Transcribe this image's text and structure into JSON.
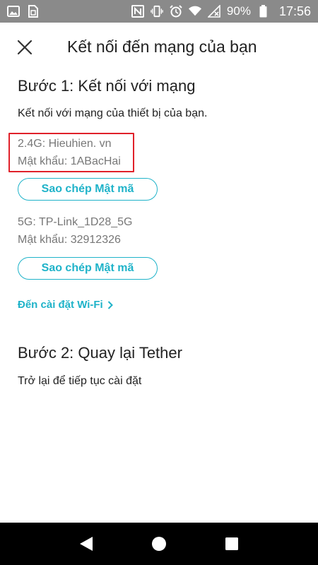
{
  "status_bar": {
    "battery_percent": "90%",
    "time": "17:56",
    "icons": [
      "image-icon",
      "sim-card-icon",
      "nfc-icon",
      "vibrate-icon",
      "alarm-icon",
      "wifi-icon",
      "no-signal-icon",
      "battery-icon"
    ]
  },
  "header": {
    "title": "Kết nối đến mạng của bạn",
    "close_icon": "close-icon"
  },
  "step1": {
    "title": "Bước 1: Kết nối với mạng",
    "description": "Kết nối với mạng của thiết bị của bạn.",
    "network_24": {
      "ssid_line": "2.4G: Hieuhien. vn",
      "password_line": "Mật khẩu: 1ABacHai",
      "copy_label": "Sao chép Mật mã"
    },
    "network_5": {
      "ssid_line": "5G: TP-Link_1D28_5G",
      "password_line": "Mật khẩu: 32912326",
      "copy_label": "Sao chép Mật mã"
    },
    "wifi_link": "Đến cài đặt Wi-Fi"
  },
  "step2": {
    "title": "Bước 2: Quay lại Tether",
    "description": "Trở lại để tiếp tục cài đặt"
  },
  "colors": {
    "accent": "#1fb3c9",
    "highlight": "#e0212a",
    "status_bar": "#8a8a8a",
    "nav_bar": "#000000"
  },
  "nav_bar": {
    "icons": [
      "back-icon",
      "home-icon",
      "recents-icon"
    ]
  }
}
